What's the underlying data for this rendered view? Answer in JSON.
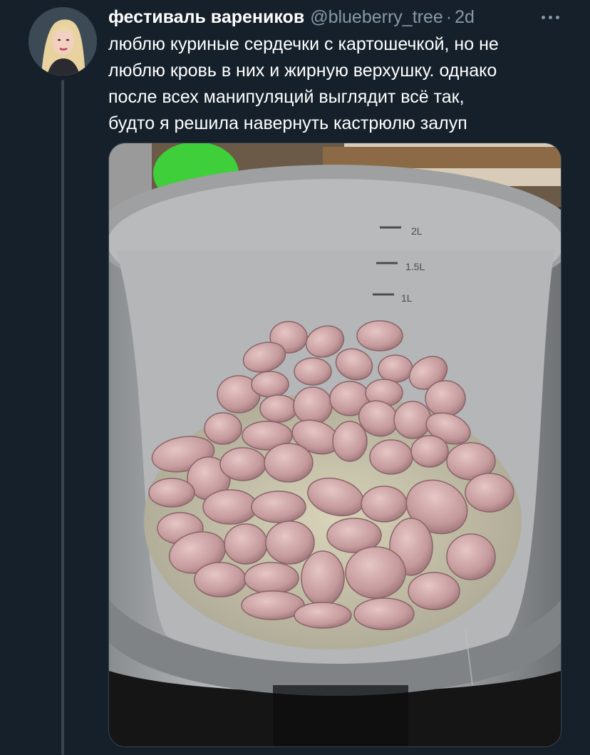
{
  "tweet": {
    "display_name": "фестиваль вареников",
    "handle": "@blueberry_tree",
    "separator": "·",
    "time": "2d",
    "text_lines": [
      "люблю куриные сердечки с картошечкой, но не",
      "люблю кровь в них и жирную верхушку. однако",
      "после всех манипуляций выглядит всё так,",
      "будто я решила навернуть кастрюлю залуп"
    ]
  },
  "media": {
    "pot_markings": [
      "2L",
      "1.5L",
      "1L"
    ]
  },
  "icons": {
    "more": "more-horizontal-icon",
    "avatar": "avatar-photo"
  },
  "colors": {
    "background": "#15202b",
    "text": "#ffffff",
    "secondary_text": "#8899a6",
    "thread_line": "#38444d"
  }
}
